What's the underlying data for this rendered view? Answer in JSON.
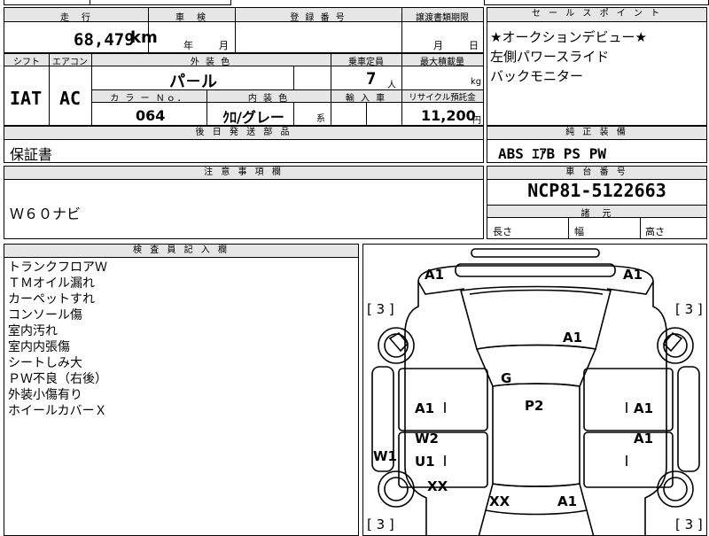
{
  "top_clip": {
    "text": "..."
  },
  "row1": {
    "mileage_label": "走　行",
    "mileage_value": "68,479",
    "mileage_unit": "km",
    "inspection_label": "車　検",
    "inspection_year_unit": "年",
    "inspection_month_unit": "月",
    "registration_label": "登 録 番 号",
    "deadline_label": "譲渡書類期限",
    "deadline_month_unit": "月",
    "deadline_day_unit": "日"
  },
  "row2": {
    "shift_label": "シフト",
    "ac_label": "エアコン",
    "shift_value": "IAT",
    "ac_value": "AC",
    "exterior_label": "外 装 色",
    "exterior_value": "パ－ル",
    "capacity_label": "乗車定員",
    "capacity_value": "7",
    "capacity_unit": "人",
    "load_label": "最大積載量",
    "load_unit": "kg",
    "color_no_label": "カ ラ ー Ｎｏ．",
    "color_no_value": "064",
    "interior_label": "内 装 色",
    "interior_value": "ｸﾛ/グレー",
    "interior_suffix": "系",
    "import_label": "輸 入 車",
    "recycle_label": "リサイクル預託金",
    "recycle_value": "11,200",
    "recycle_unit": "円"
  },
  "post_parts": {
    "header": "後 日 発 送 部 品",
    "value": "保証書"
  },
  "sales_points": {
    "header": "セ ー ル ス ポ イ ン ト",
    "lines": [
      "★オークションデビュー★",
      "左側パワースライド",
      "バックモニター"
    ]
  },
  "standard_equipment": {
    "header": "純 正 装 備",
    "value": "ABS ｴｱB PS PW"
  },
  "notes": {
    "header": "注 意 事 項 欄",
    "value": "Ｗ６０ナビ"
  },
  "chassis": {
    "header": "車 台 番 号",
    "value": "NCP81-5122663"
  },
  "dimensions": {
    "header": "諸　元",
    "length": "長さ",
    "width": "幅",
    "height": "高さ"
  },
  "inspector": {
    "header": "検 査 員 記 入 欄",
    "lines": [
      "トランクフロアＷ",
      "ＴＭオイル漏れ",
      "カーペットすれ",
      "コンソール傷",
      "室内汚れ",
      "室内内張傷",
      "シートしみ大",
      "ＰＷ不良（右後）",
      "外装小傷有り",
      "ホイールカバーＸ"
    ]
  },
  "diagram": {
    "marks": {
      "front_left": "A1",
      "front_right": "A1",
      "hood": "A1",
      "roof_front": "G",
      "roof": "P2",
      "left_front_door": "A1",
      "right_front_door": "A1",
      "left_rear_door_1": "W2",
      "left_rear_door_2": "U1",
      "right_rear_door": "A1",
      "left_sill": "W1",
      "left_rear_quarter": "XX",
      "rear": "XX",
      "rear_right": "A1"
    },
    "tire_labels": {
      "fl": "[ 3 ]",
      "fr": "[ 3 ]",
      "rl": "[ 3 ]",
      "rr": "[ 3 ]"
    }
  }
}
